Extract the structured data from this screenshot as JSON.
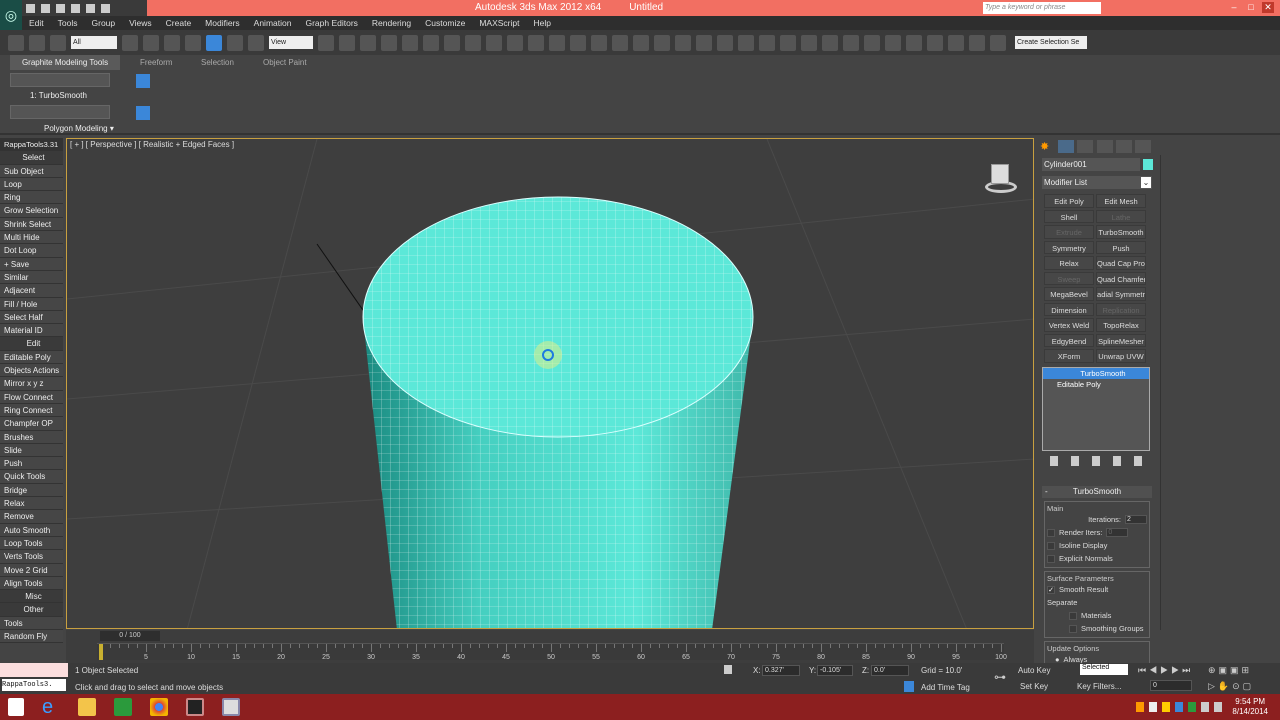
{
  "titlebar": {
    "app": "Autodesk 3ds Max  2012 x64",
    "doc": "Untitled",
    "search_placeholder": "Type a keyword or phrase"
  },
  "menu": [
    "Edit",
    "Tools",
    "Group",
    "Views",
    "Create",
    "Modifiers",
    "Animation",
    "Graph Editors",
    "Rendering",
    "Customize",
    "MAXScript",
    "Help"
  ],
  "toolbar": {
    "selection_filter": "All",
    "ref_coord": "View",
    "named_selection": "Create Selection Se"
  },
  "ribbon": {
    "tabs": [
      "Graphite Modeling Tools",
      "Freeform",
      "Selection",
      "Object Paint"
    ],
    "modifier_label": "1: TurboSmooth",
    "panel": "Polygon Modeling ▾"
  },
  "sidebar": {
    "items": [
      {
        "t": "RappaTools3.31",
        "k": "hdr"
      },
      {
        "t": "Select",
        "k": "sec"
      },
      {
        "t": "Sub Object"
      },
      {
        "t": "Loop"
      },
      {
        "t": "Ring"
      },
      {
        "t": "Grow Selection"
      },
      {
        "t": "Shrink Select"
      },
      {
        "t": "Multi Hide"
      },
      {
        "t": "Dot Loop"
      },
      {
        "t": "+ Save"
      },
      {
        "t": "Similar"
      },
      {
        "t": "Adjacent"
      },
      {
        "t": "Fill / Hole"
      },
      {
        "t": "Select Half"
      },
      {
        "t": "Material ID"
      },
      {
        "t": "Edit",
        "k": "sec"
      },
      {
        "t": "Editable Poly"
      },
      {
        "t": "Objects Actions"
      },
      {
        "t": "Mirror   x  y  z"
      },
      {
        "t": "Flow Connect"
      },
      {
        "t": "Ring Connect"
      },
      {
        "t": "Champfer OP"
      },
      {
        "t": "Brushes"
      },
      {
        "t": "Slide"
      },
      {
        "t": "Push"
      },
      {
        "t": "Quick Tools"
      },
      {
        "t": "Bridge"
      },
      {
        "t": "Relax"
      },
      {
        "t": "Remove"
      },
      {
        "t": "Auto Smooth"
      },
      {
        "t": "Loop Tools"
      },
      {
        "t": "Verts Tools"
      },
      {
        "t": "Move 2 Grid"
      },
      {
        "t": "Align Tools"
      },
      {
        "t": "Misc",
        "k": "sec"
      },
      {
        "t": "Other",
        "k": "sec"
      },
      {
        "t": "Tools"
      },
      {
        "t": "Random Fly"
      }
    ]
  },
  "viewport": {
    "label": "[ + ] [ Perspective ] [ Realistic + Edged Faces ]",
    "object_color": "#5ce8d8"
  },
  "command_panel": {
    "object_name": "Cylinder001",
    "modifier_list": "Modifier List",
    "buttons": [
      {
        "t": "Edit Poly"
      },
      {
        "t": "Edit Mesh"
      },
      {
        "t": "Shell"
      },
      {
        "t": "Lathe",
        "d": true
      },
      {
        "t": "Extrude",
        "d": true
      },
      {
        "t": "TurboSmooth"
      },
      {
        "t": "Symmetry"
      },
      {
        "t": "Push"
      },
      {
        "t": "Relax"
      },
      {
        "t": "Quad Cap Pro"
      },
      {
        "t": "Sweep",
        "d": true
      },
      {
        "t": "Quad Chamfer"
      },
      {
        "t": "MegaBevel"
      },
      {
        "t": "adial Symmetr"
      },
      {
        "t": "Dimension"
      },
      {
        "t": "Replication",
        "d": true
      },
      {
        "t": "Vertex Weld"
      },
      {
        "t": "TopoRelax"
      },
      {
        "t": "EdgyBend"
      },
      {
        "t": "SplineMesher"
      },
      {
        "t": "XForm"
      },
      {
        "t": "Unwrap UVW"
      }
    ],
    "stack": [
      "TurboSmooth",
      "Editable Poly"
    ],
    "rollout": {
      "title": "TurboSmooth",
      "collapse": "-",
      "main": "Main",
      "iterations_label": "Iterations:",
      "iterations": "2",
      "render_iters_label": "Render Iters:",
      "render_iters": "0",
      "isoline": "Isoline Display",
      "explicit": "Explicit Normals",
      "surface": "Surface Parameters",
      "smooth_result": "Smooth Result",
      "separate": "Separate",
      "materials": "Materials",
      "smoothing_groups": "Smoothing Groups",
      "update": "Update Options",
      "always": "Always"
    }
  },
  "timeline": {
    "frame": "0 / 100",
    "current": 0,
    "ticks": [
      "0",
      "5",
      "10",
      "15",
      "20",
      "25",
      "30",
      "35",
      "40",
      "45",
      "50",
      "55",
      "60",
      "65",
      "70",
      "75",
      "80",
      "85",
      "90",
      "95",
      "100"
    ]
  },
  "status": {
    "selected": "1 Object Selected",
    "prompt": "Click and drag to select and move objects",
    "listener": "RappaTools3.",
    "x_label": "X:",
    "x": "0.327'",
    "y_label": "Y:",
    "y": "-0.105'",
    "z_label": "Z:",
    "z": "0.0'",
    "grid": "Grid = 10.0'",
    "auto_key": "Auto Key",
    "key_mode": "Selected",
    "set_key": "Set Key",
    "key_filters": "Key Filters...",
    "frame_field": "0",
    "add_time_tag": "Add Time Tag"
  },
  "taskbar": {
    "time": "9:54 PM",
    "date": "8/14/2014"
  }
}
